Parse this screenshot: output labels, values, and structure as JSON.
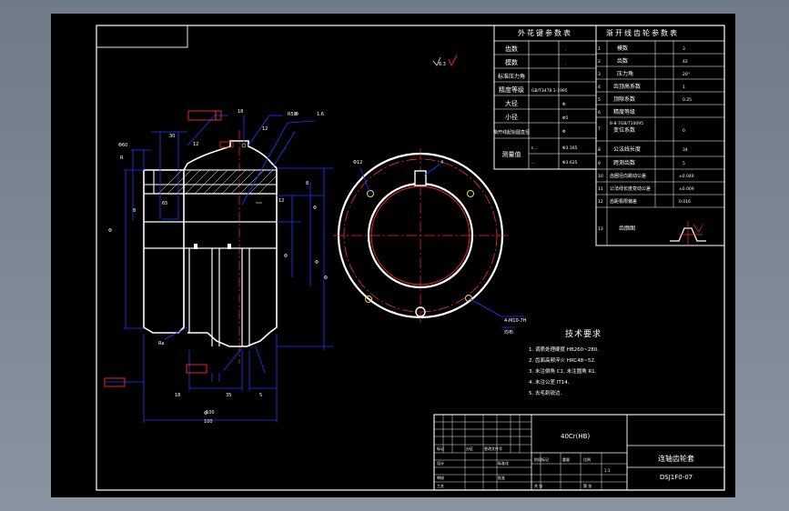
{
  "spline_table": {
    "title": "外花键参数表",
    "rows": [
      "齿数",
      "模数",
      "标准压力角",
      "精度等级",
      "大径",
      "小径",
      "渐开线起始圆直径",
      "测量值"
    ]
  },
  "gear_table": {
    "title": "渐开线齿轮参数表",
    "rows": [
      "模数",
      "齿数",
      "压力角",
      "齿顶高系数",
      "顶隙系数",
      "精度等级",
      "变位系数",
      "公法线长度",
      "跨测齿数",
      "齿圈径向跳动公差",
      "公法线长度变动公差",
      "齿距极限偏差",
      "齿形公差",
      "齿向公差",
      "齿廓图"
    ]
  },
  "tech_req": {
    "title": "技术要求",
    "items": [
      "1. 调质处理硬度 HB260~280.",
      "2. 齿面高频淬火 HRC48~52.",
      "3. 未注倒角 C1, 未注圆角 R1.",
      "4. 未注公差 IT14.",
      "5. 去毛刺锐边."
    ]
  },
  "title_block": {
    "material": "40Cr(HB)",
    "part_name": "连轴齿轮套",
    "drawing_no": "DSJ1F0-07"
  },
  "dimensions": {
    "top": "R50",
    "bottom_width": "100"
  },
  "colors": {
    "background": "#000000",
    "line": "#ffffff",
    "dimension": "#1b3bff",
    "center": "#ff2a2a",
    "accent": "#e0e060",
    "viewport": "#7d8895"
  }
}
